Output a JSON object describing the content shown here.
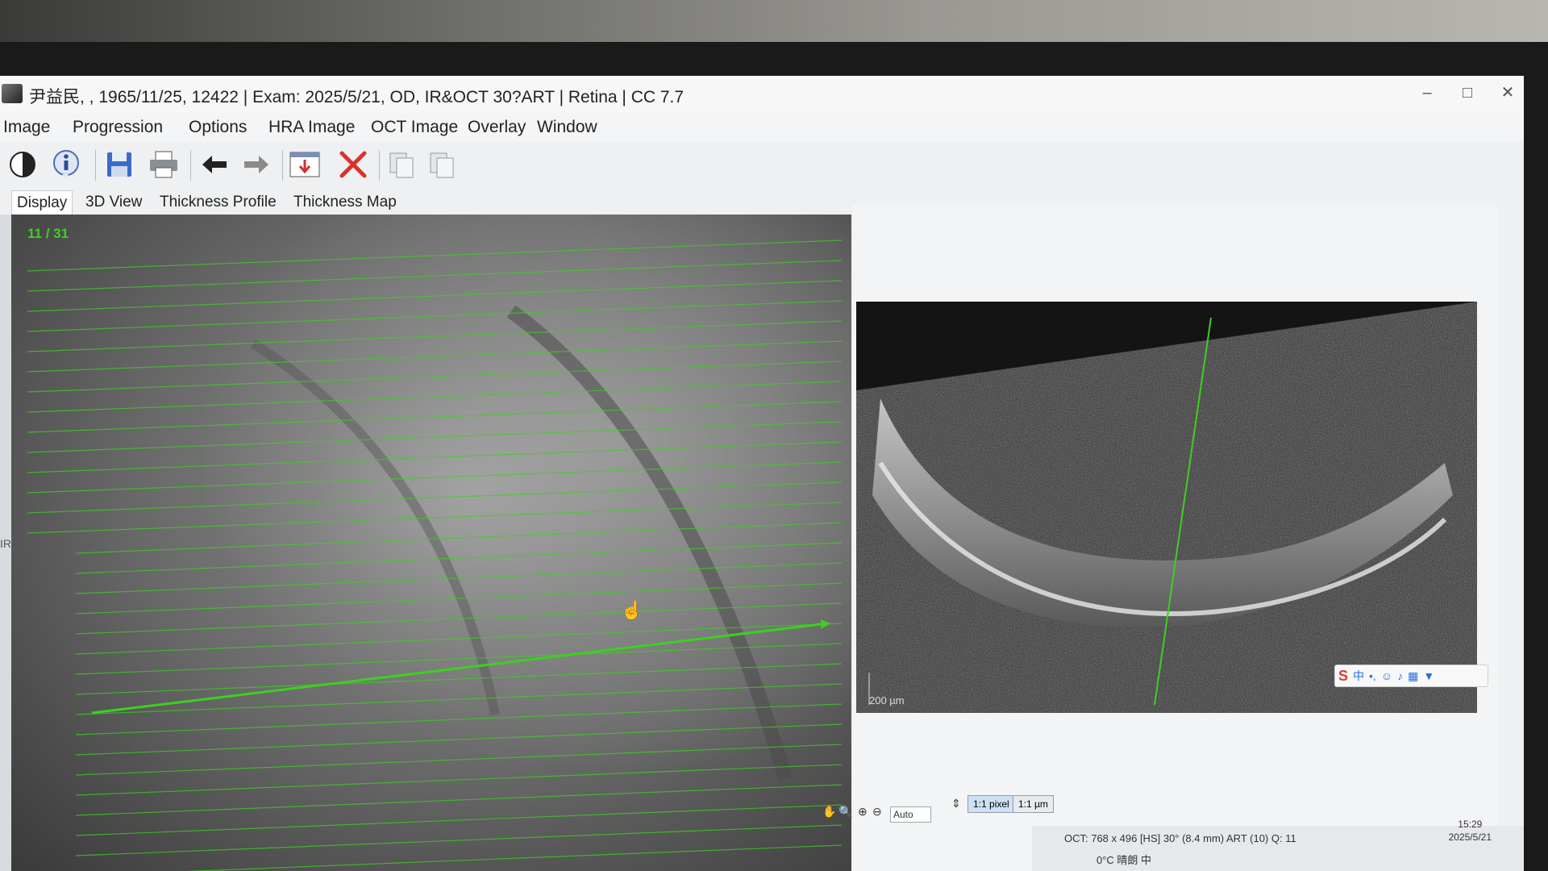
{
  "window": {
    "title": "尹益民,      , 1965/11/25, 12422  |  Exam: 2025/5/21, OD, IR&OCT 30?ART  |  Retina  |  CC 7.7",
    "controls": {
      "minimize": "–",
      "maximize": "□",
      "close": "✕"
    }
  },
  "menu": [
    "Image",
    "Progression",
    "Options",
    "HRA Image",
    "OCT Image",
    "Overlay",
    "Window"
  ],
  "toolbar_icons": [
    "contrast-icon",
    "info-icon",
    "save-icon",
    "print-icon",
    "back-arrow-icon",
    "forward-arrow-icon",
    "export-icon",
    "delete-icon",
    "copy-icon",
    "paste-icon"
  ],
  "tabs": [
    "Display",
    "3D View",
    "Thickness Profile",
    "Thickness Map"
  ],
  "active_tab": "Display",
  "left_strip_label": "IR&",
  "fundus": {
    "scan_counter": "11 / 31",
    "scan_line_color": "#3cd020",
    "selected_scan": 11,
    "total_scans": 31
  },
  "oct": {
    "scale_label": "200 µm",
    "scan_line_color": "#3cd020"
  },
  "controls": {
    "zoom_select": "Auto",
    "pixel_btn": "1:1 pixel",
    "um_btn": "1:1 µm"
  },
  "status": {
    "scan_info": "OCT: 768 x 496 [HS] 30° (8.4 mm) ART (10) Q: 11",
    "tray": "0°C 晴朗   中",
    "time": "15:29",
    "date": "2025/5/21"
  },
  "ime_label": "中"
}
